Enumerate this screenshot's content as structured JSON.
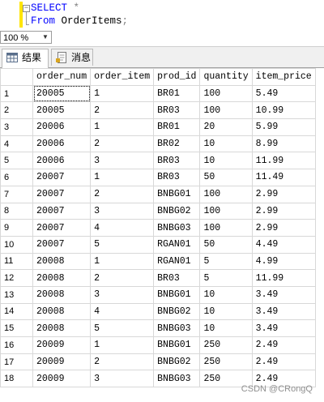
{
  "editor": {
    "collapse_symbol": "−",
    "line1_keyword": "SELECT",
    "line1_rest": " *",
    "line2_keyword": "From",
    "line2_table": " OrderItems",
    "line2_end": ";"
  },
  "zoom": {
    "value": "100 %",
    "arrow": "▼"
  },
  "tabs": [
    {
      "label": "结果"
    },
    {
      "label": "消息"
    }
  ],
  "grid": {
    "columns": [
      "order_num",
      "order_item",
      "prod_id",
      "quantity",
      "item_price"
    ],
    "rows": [
      [
        "1",
        "20005",
        "1",
        "BR01",
        "100",
        "5.49"
      ],
      [
        "2",
        "20005",
        "2",
        "BR03",
        "100",
        "10.99"
      ],
      [
        "3",
        "20006",
        "1",
        "BR01",
        "20",
        "5.99"
      ],
      [
        "4",
        "20006",
        "2",
        "BR02",
        "10",
        "8.99"
      ],
      [
        "5",
        "20006",
        "3",
        "BR03",
        "10",
        "11.99"
      ],
      [
        "6",
        "20007",
        "1",
        "BR03",
        "50",
        "11.49"
      ],
      [
        "7",
        "20007",
        "2",
        "BNBG01",
        "100",
        "2.99"
      ],
      [
        "8",
        "20007",
        "3",
        "BNBG02",
        "100",
        "2.99"
      ],
      [
        "9",
        "20007",
        "4",
        "BNBG03",
        "100",
        "2.99"
      ],
      [
        "10",
        "20007",
        "5",
        "RGAN01",
        "50",
        "4.49"
      ],
      [
        "11",
        "20008",
        "1",
        "RGAN01",
        "5",
        "4.99"
      ],
      [
        "12",
        "20008",
        "2",
        "BR03",
        "5",
        "11.99"
      ],
      [
        "13",
        "20008",
        "3",
        "BNBG01",
        "10",
        "3.49"
      ],
      [
        "14",
        "20008",
        "4",
        "BNBG02",
        "10",
        "3.49"
      ],
      [
        "15",
        "20008",
        "5",
        "BNBG03",
        "10",
        "3.49"
      ],
      [
        "16",
        "20009",
        "1",
        "BNBG01",
        "250",
        "2.49"
      ],
      [
        "17",
        "20009",
        "2",
        "BNBG02",
        "250",
        "2.49"
      ],
      [
        "18",
        "20009",
        "3",
        "BNBG03",
        "250",
        "2.49"
      ]
    ]
  },
  "watermark": "CSDN @CRongQ"
}
